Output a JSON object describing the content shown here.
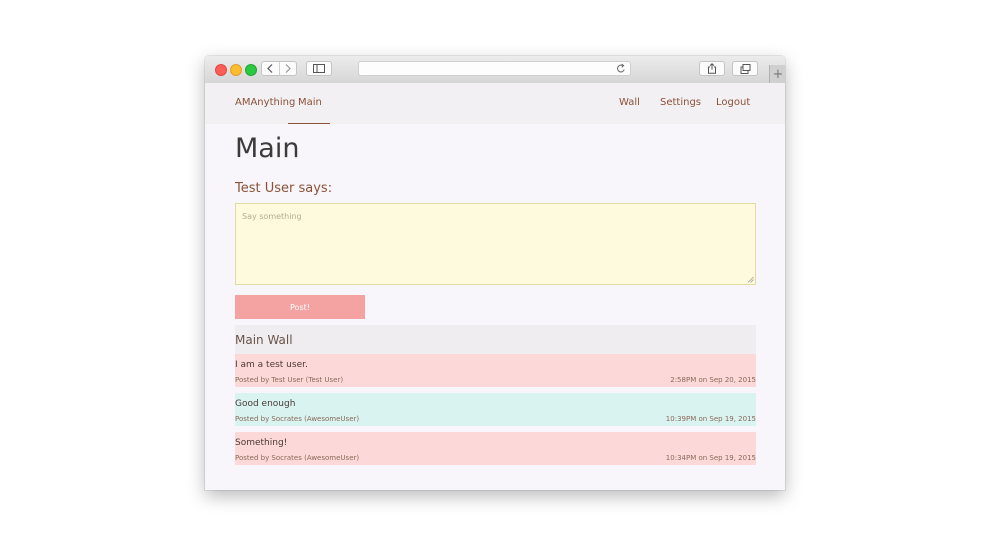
{
  "browser": {
    "new_tab_label": "+"
  },
  "nav": {
    "brand": "AMAnything",
    "main": "Main",
    "wall": "Wall",
    "settings": "Settings",
    "logout": "Logout"
  },
  "page": {
    "title": "Main",
    "says": "Test User says:",
    "textarea_placeholder": "Say something",
    "post_button": "Post!"
  },
  "wall": {
    "title": "Main Wall",
    "posts": [
      {
        "text": "I am a test user.",
        "meta": "Posted by Test User (Test User)",
        "time": "2:58PM on Sep 20, 2015",
        "color": "#fdd8d8"
      },
      {
        "text": "Good enough",
        "meta": "Posted by Socrates (AwesomeUser)",
        "time": "10:39PM on Sep 19, 2015",
        "color": "#d9f3f1"
      },
      {
        "text": "Something!",
        "meta": "Posted by Socrates (AwesomeUser)",
        "time": "10:34PM on Sep 19, 2015",
        "color": "#fdd8d8"
      }
    ]
  },
  "colors": {
    "accent": "#8a5238",
    "post_button": "#f4a2a2",
    "textarea_bg": "#fdfadd"
  }
}
